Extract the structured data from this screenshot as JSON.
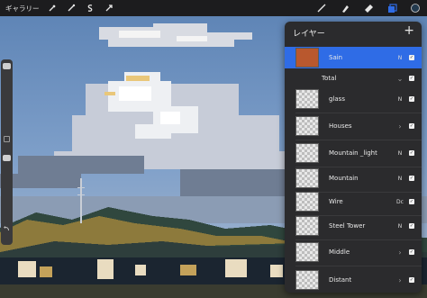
{
  "topbar": {
    "gallery_label": "ギャラリー",
    "left_tools": [
      "wrench-icon",
      "adjustments-icon",
      "selection-icon",
      "transform-icon"
    ],
    "right_tools": [
      "brush-icon",
      "smudge-icon",
      "eraser-icon",
      "layers-icon",
      "color-icon"
    ],
    "accent": "#2f6ce6"
  },
  "layers_panel": {
    "title": "レイヤー",
    "add_label": "+",
    "layers": [
      {
        "name": "Sain",
        "mode": "N",
        "control": "none",
        "checked": true,
        "active": true
      },
      {
        "name": "Total",
        "mode": "",
        "control": "collapse",
        "checked": true,
        "group": true
      },
      {
        "name": "glass",
        "mode": "N",
        "control": "none",
        "checked": true
      },
      {
        "name": "Houses",
        "mode": "",
        "control": "expand",
        "checked": true
      },
      {
        "name": "Mountain _light",
        "mode": "N",
        "control": "none",
        "checked": true
      },
      {
        "name": "Mountain",
        "mode": "N",
        "control": "none",
        "checked": true
      },
      {
        "name": "Wire",
        "mode": "Dc",
        "control": "none",
        "checked": true
      },
      {
        "name": "Steel Tower",
        "mode": "N",
        "control": "none",
        "checked": true
      },
      {
        "name": "Middle",
        "mode": "",
        "control": "expand",
        "checked": true
      },
      {
        "name": "Distant",
        "mode": "",
        "control": "expand",
        "checked": true
      }
    ]
  }
}
